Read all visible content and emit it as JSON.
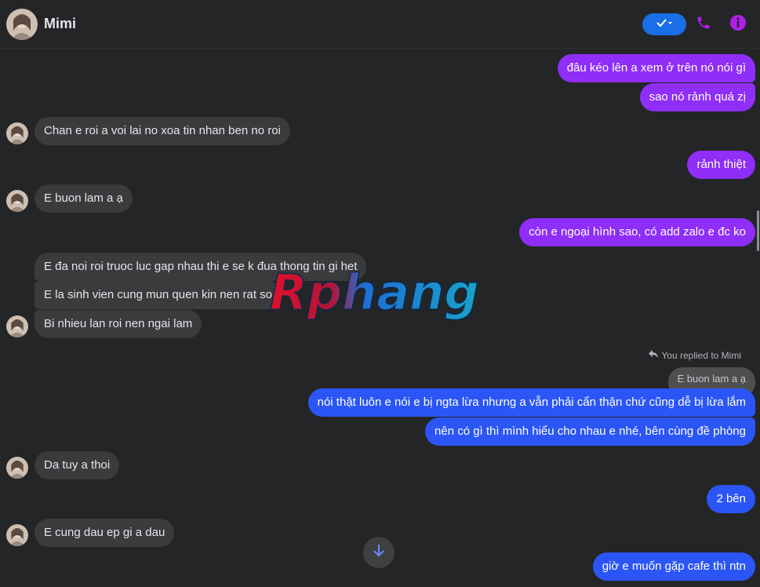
{
  "header": {
    "contact_name": "Mimi"
  },
  "watermark_text": "Rphang",
  "messages": {
    "m1": "đâu kéo lên a xem ở trên nó nói gì",
    "m2": "sao nó rảnh quá zị",
    "m3": "Chan e roi a voi lai no xoa tin nhan ben no roi",
    "m4": "rảnh thiệt",
    "m5": "E buon lam a ạ",
    "m6": "còn e ngoại hình sao, có add zalo e đc ko",
    "m7": "E đa noi roi truoc luc gap nhau thi e se k đua thong tin gi het",
    "m8": "E la sinh vien cung mun quen kin nen rat so",
    "m9": "Bi nhieu lan roi nen ngai lam",
    "m10": "nói thật luôn e nói e bị ngta lừa nhưng a vẫn phải cẩn thận chứ cũng dễ bị lừa lắm",
    "m11": "nên có gì thì mình hiểu cho nhau e nhé,  bên cùng đề phòng",
    "m12": "Da tuy a thoi",
    "m13": "2 bên",
    "m14": "E cung dau ep gi a dau",
    "m15": "giờ e muốn gặp cafe thì ntn"
  },
  "reply": {
    "label": "You replied to Mimi",
    "quoted": "E buon lam a ạ"
  },
  "colors": {
    "background": "#242526",
    "incoming_bubble": "#3a3b3c",
    "outgoing_purple": "#8e2ef7",
    "outgoing_blue": "#2b56f5",
    "accent_icon": "#b01ee8"
  },
  "icons": [
    "verified-check-icon",
    "phone-icon",
    "info-icon",
    "reply-arrow-icon",
    "arrow-down-icon"
  ]
}
